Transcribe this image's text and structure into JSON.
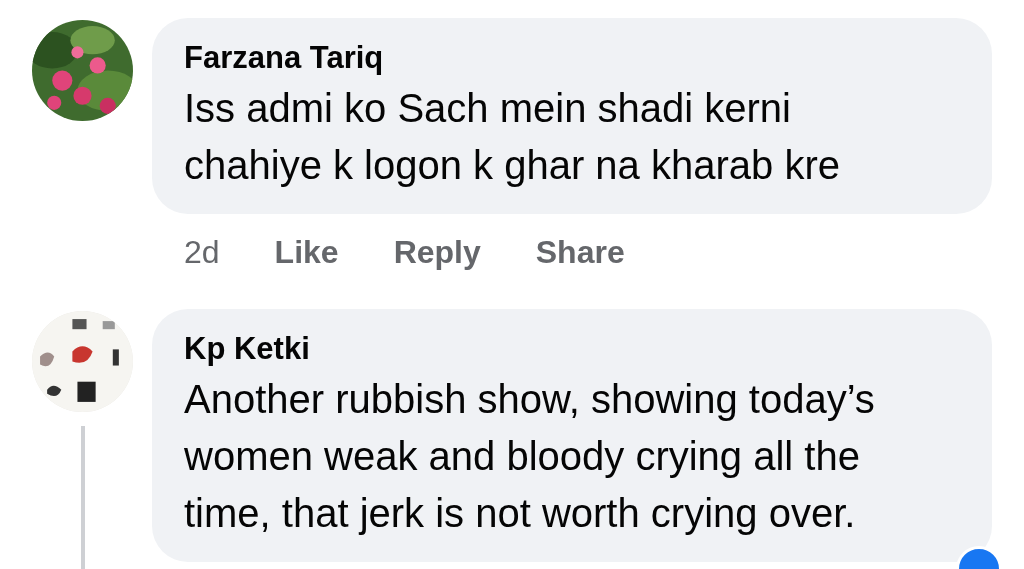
{
  "comments": [
    {
      "author": "Farzana Tariq",
      "text": "Iss admi ko Sach mein shadi kerni chahiye k logon k ghar na kharab kre",
      "time": "2d",
      "actions": [
        "Like",
        "Reply",
        "Share"
      ],
      "thread_line": false,
      "reactions": false
    },
    {
      "author": "Kp Ketki",
      "text": "Another rubbish show, showing today’s women weak and bloody crying all the time, that jerk is not worth crying over.",
      "thread_line": true,
      "reactions": true
    }
  ]
}
